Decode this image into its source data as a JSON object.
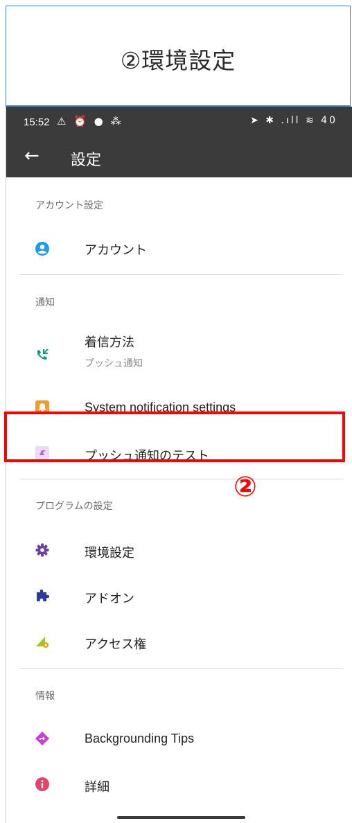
{
  "banner": {
    "title": "②環境設定"
  },
  "statusbar": {
    "time": "15:52",
    "left_icons": "⚠ ⏰ ● ⁂",
    "right_icons": "➤ ✱ .ıll ≋ 40"
  },
  "appbar": {
    "back_icon": "←",
    "title": "設定"
  },
  "sections": {
    "account": {
      "header": "アカウント設定",
      "items": {
        "account": "アカウント"
      }
    },
    "notify": {
      "header": "通知",
      "items": {
        "incoming": "着信方法",
        "incoming_sub": "プッシュ通知",
        "system": "System notification settings",
        "push_test": "プッシュ通知のテスト"
      }
    },
    "program": {
      "header": "プログラムの設定",
      "items": {
        "preferences": "環境設定",
        "addons": "アドオン",
        "access": "アクセス権"
      }
    },
    "info": {
      "header": "情報",
      "items": {
        "tips": "Backgrounding Tips",
        "details": "詳細"
      }
    }
  },
  "callout": {
    "text": "②"
  },
  "colors": {
    "highlight": "#ff0000",
    "account_icon": "#1e9de6",
    "incoming_icon": "#1a9a80",
    "system_icon": "#f19a2e",
    "push_icon": "#b06cd6",
    "gear_icon": "#6a3fa6",
    "addon_icon": "#2c3a9f",
    "access_icon": "#a5c628",
    "tips_icon": "#c940d6",
    "details_icon": "#e0456c"
  }
}
